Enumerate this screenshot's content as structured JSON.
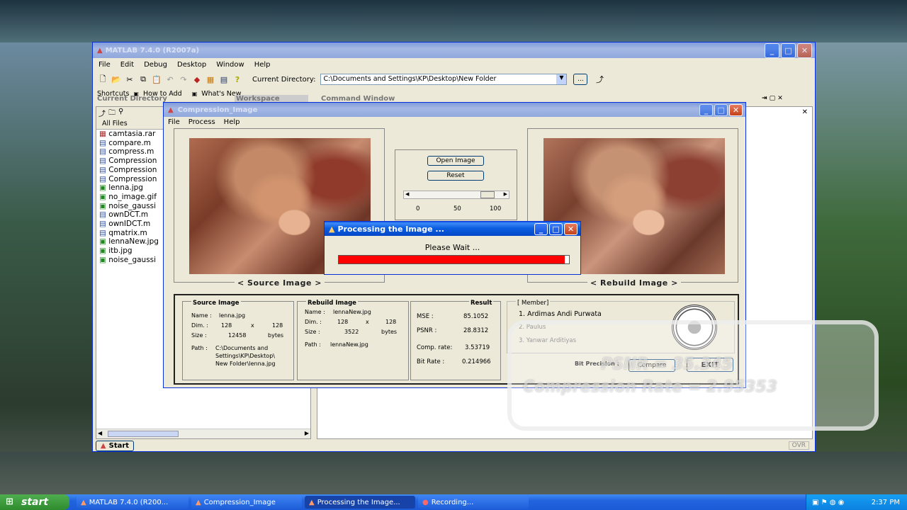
{
  "matlab": {
    "title": "MATLAB  7.4.0 (R2007a)",
    "menu": [
      "File",
      "Edit",
      "Debug",
      "Desktop",
      "Window",
      "Help"
    ],
    "current_dir_label": "Current Directory:",
    "current_dir_value": "C:\\Documents and Settings\\KP\\Desktop\\New Folder",
    "browse_label": "...",
    "shortcuts_label": "Shortcuts",
    "how_to_add": "How to Add",
    "whats_new": "What's New",
    "current_dir_panel": "Current Directory",
    "workspace_tab": "Workspace",
    "command_window_tab": "Command Window",
    "all_files_header": "All Files",
    "files": [
      "camtasia.rar",
      "compare.m",
      "compress.m",
      "Compression",
      "Compression",
      "Compression",
      "lenna.jpg",
      "no_image.gif",
      "noise_gaussi",
      "ownDCT.m",
      "ownIDCT.m",
      "qmatrix.m",
      "lennaNew.jpg",
      "itb.jpg",
      "noise_gaussi"
    ],
    "start_button": "Start",
    "ovr": "OVR"
  },
  "compression_app": {
    "title": "Compression_Image",
    "menu": [
      "File",
      "Process",
      "Help"
    ],
    "open_image": "Open Image",
    "reset": "Reset",
    "slider_ticks": [
      "0",
      "50",
      "100"
    ],
    "source_caption": "< Source Image >",
    "rebuild_caption": "< Rebuild Image >",
    "source_info": {
      "header": "Source Image",
      "name_label": "Name  :",
      "name_value": "lenna.jpg",
      "dim_label": "Dim.  :",
      "dim_w": "128",
      "dim_x": "x",
      "dim_h": "128",
      "size_label": "Size  :",
      "size_value": "12458",
      "size_unit": "bytes",
      "path_label": "Path  :",
      "path_value_1": "C:\\Documents and",
      "path_value_2": "Settings\\KP\\Desktop\\",
      "path_value_3": "New Folder\\lenna.jpg"
    },
    "rebuild_info": {
      "header": "Rebuild Image",
      "name_label": "Name  :",
      "name_value": "lennaNew.jpg",
      "dim_label": "Dim.  :",
      "dim_w": "128",
      "dim_x": "x",
      "dim_h": "128",
      "size_label": "Size  :",
      "size_value": "3522",
      "size_unit": "bytes",
      "path_label": "Path  :",
      "path_value": "lennaNew.jpg"
    },
    "result": {
      "header": "Result",
      "mse_label": "MSE    :",
      "mse_value": "85.1052",
      "psnr_label": "PSNR    :",
      "psnr_value": "28.8312",
      "comp_label": "Comp. rate:",
      "comp_value": "3.53719",
      "bit_label": "Bit Rate  :",
      "bit_value": "0.214966"
    },
    "members": {
      "header": "[ Member]",
      "m1": "1. Ardimas Andi Purwata",
      "m2": "2. Paulus",
      "m3": "3. Yanwar Arditiyas"
    },
    "bit_precision_label": "Bit Precision :",
    "compare_button": "Compare",
    "exit_button": "EXIT"
  },
  "processing_dialog": {
    "title": "Processing the Image ...",
    "message": "Please Wait ...",
    "progress": 0.98
  },
  "overlay": {
    "psnr_text": "PSNR = 35.345",
    "compression_text": "Compression Rate = 2.95353"
  },
  "taskbar": {
    "start": "start",
    "tasks": [
      "MATLAB  7.4.0 (R200...",
      "Compression_Image",
      "Processing the Image...",
      "Recording..."
    ],
    "clock": "2:37 PM"
  }
}
